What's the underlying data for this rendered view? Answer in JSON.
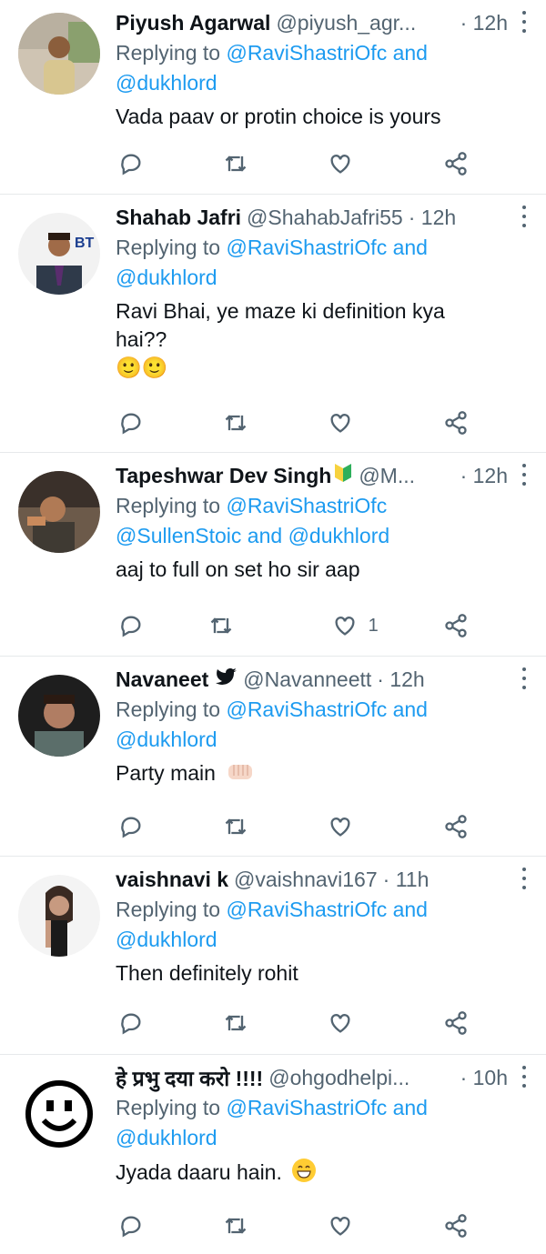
{
  "tweets": [
    {
      "name": "Piyush Agarwal",
      "handle": "@piyush_agr...",
      "time": "· 12h",
      "replying_prefix": "Replying to",
      "replying_users": "@RaviShastriOfc and",
      "replying_users2": "@dukhlord",
      "text": "Vada paav or protin choice is yours",
      "like_count": ""
    },
    {
      "name": "Shahab Jafri",
      "handle": "@ShahabJafri55",
      "time": "· 12h",
      "replying_prefix": "Replying to",
      "replying_users": "@RaviShastriOfc and",
      "replying_users2": "@dukhlord",
      "text": "Ravi Bhai, ye maze ki definition kya",
      "text2": "hai??",
      "emoji_text": "🙂🙂",
      "like_count": ""
    },
    {
      "name": "Tapeshwar Dev Singh",
      "handle": "@M...",
      "time": "· 12h",
      "replying_prefix": "Replying to",
      "replying_users": "@RaviShastriOfc",
      "replying_users2": "@SullenStoic and @dukhlord",
      "text": "aaj to full on set ho sir aap",
      "like_count": "1"
    },
    {
      "name": "Navaneet",
      "handle": "@Navanneett",
      "time": "· 12h",
      "replying_prefix": "Replying to",
      "replying_users": "@RaviShastriOfc and",
      "replying_users2": "@dukhlord",
      "text": "Party main",
      "like_count": ""
    },
    {
      "name": "vaishnavi k",
      "handle": "@vaishnavi167",
      "time": "· 11h",
      "replying_prefix": "Replying to",
      "replying_users": "@RaviShastriOfc and",
      "replying_users2": "@dukhlord",
      "text": "Then definitely rohit",
      "like_count": ""
    },
    {
      "name": "हे प्रभु दया करो !!!!",
      "handle": "@ohgodhelpi...",
      "time": "· 10h",
      "replying_prefix": "Replying to",
      "replying_users": "@RaviShastriOfc and",
      "replying_users2": "@dukhlord",
      "text": "Jyada daaru hain.",
      "like_count": ""
    }
  ],
  "icons": {
    "reply": "reply-icon",
    "retweet": "retweet-icon",
    "like": "heart-icon",
    "share": "share-icon",
    "more": "more-icon"
  }
}
